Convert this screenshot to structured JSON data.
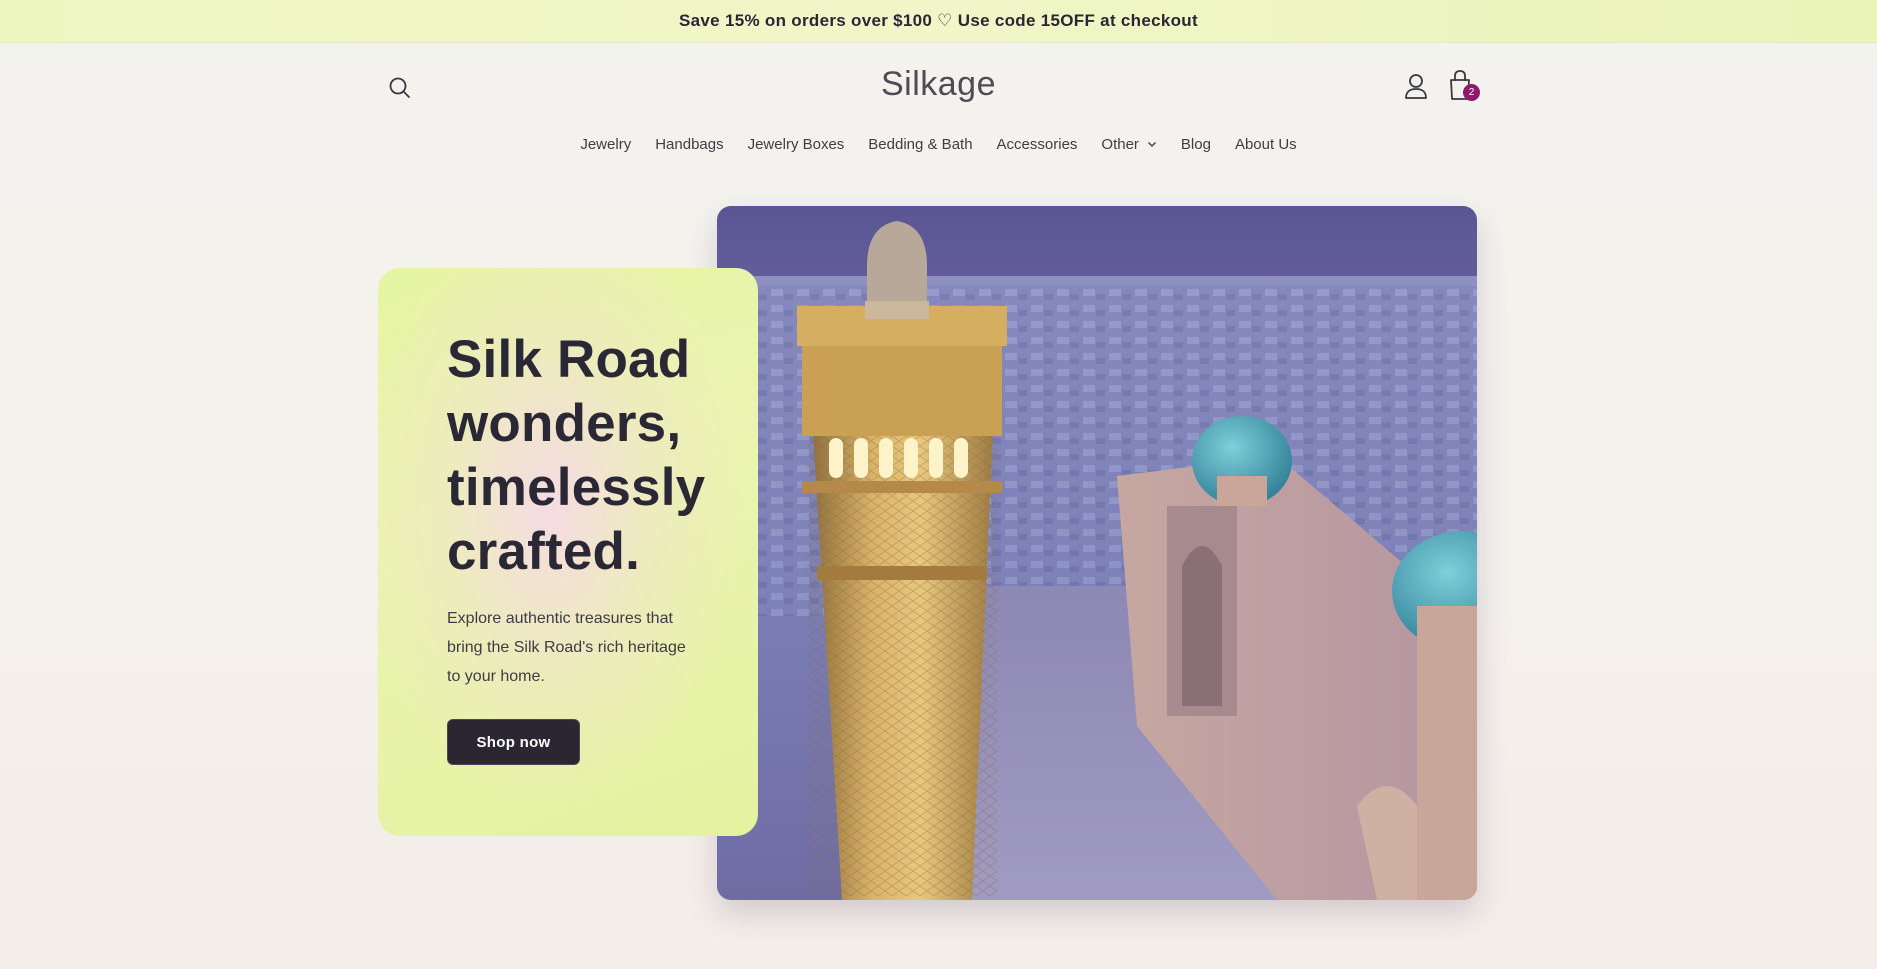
{
  "announcement": {
    "text": "Save 15% on orders over $100 ♡ Use code 15OFF at checkout"
  },
  "header": {
    "logo": "Silkage",
    "cart_count": "2"
  },
  "nav": {
    "items": [
      {
        "label": "Jewelry"
      },
      {
        "label": "Handbags"
      },
      {
        "label": "Jewelry Boxes"
      },
      {
        "label": "Bedding & Bath"
      },
      {
        "label": "Accessories"
      },
      {
        "label": "Other"
      },
      {
        "label": "Blog"
      },
      {
        "label": "About Us"
      }
    ]
  },
  "hero": {
    "title": "Silk Road wonders, timelessly crafted.",
    "subtitle": "Explore authentic treasures that bring the Silk Road's rich heritage to your home.",
    "cta_label": "Shop now"
  },
  "colors": {
    "announcement_bg": "#eef6c0",
    "card_bg": "#e6f5a2",
    "button_bg": "#2a2733",
    "badge": "#8c1b6b"
  }
}
